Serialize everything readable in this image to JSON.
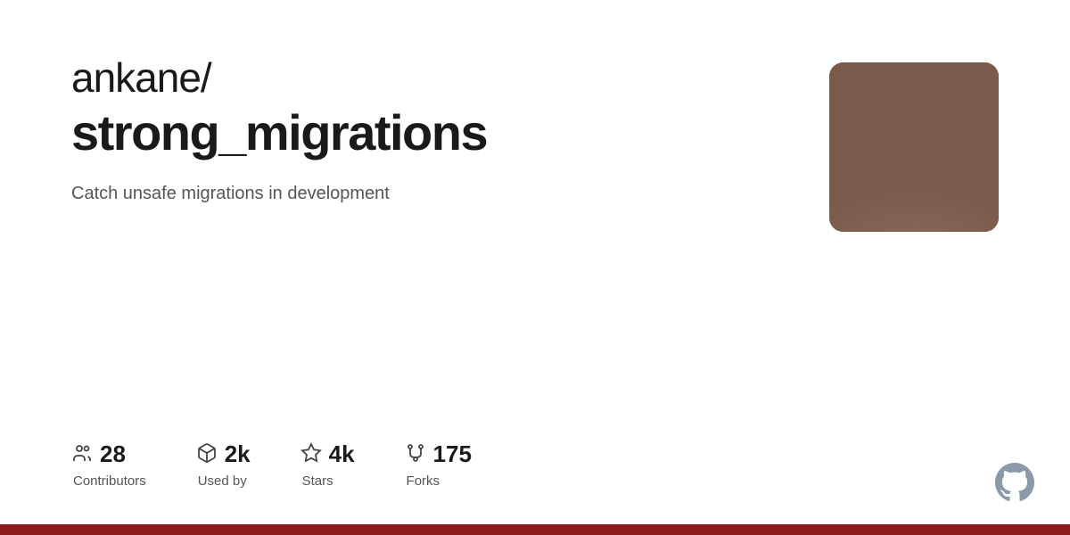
{
  "repo": {
    "owner": "ankane/",
    "name": "strong_migrations",
    "description": "Catch unsafe migrations in development"
  },
  "stats": [
    {
      "id": "contributors",
      "icon": "contributors-icon",
      "number": "28",
      "label": "Contributors"
    },
    {
      "id": "used-by",
      "icon": "package-icon",
      "number": "2k",
      "label": "Used by"
    },
    {
      "id": "stars",
      "icon": "star-icon",
      "number": "4k",
      "label": "Stars"
    },
    {
      "id": "forks",
      "icon": "fork-icon",
      "number": "175",
      "label": "Forks"
    }
  ],
  "colors": {
    "bottom_bar": "#8b1a1a",
    "github_icon": "#7a8a9a"
  }
}
